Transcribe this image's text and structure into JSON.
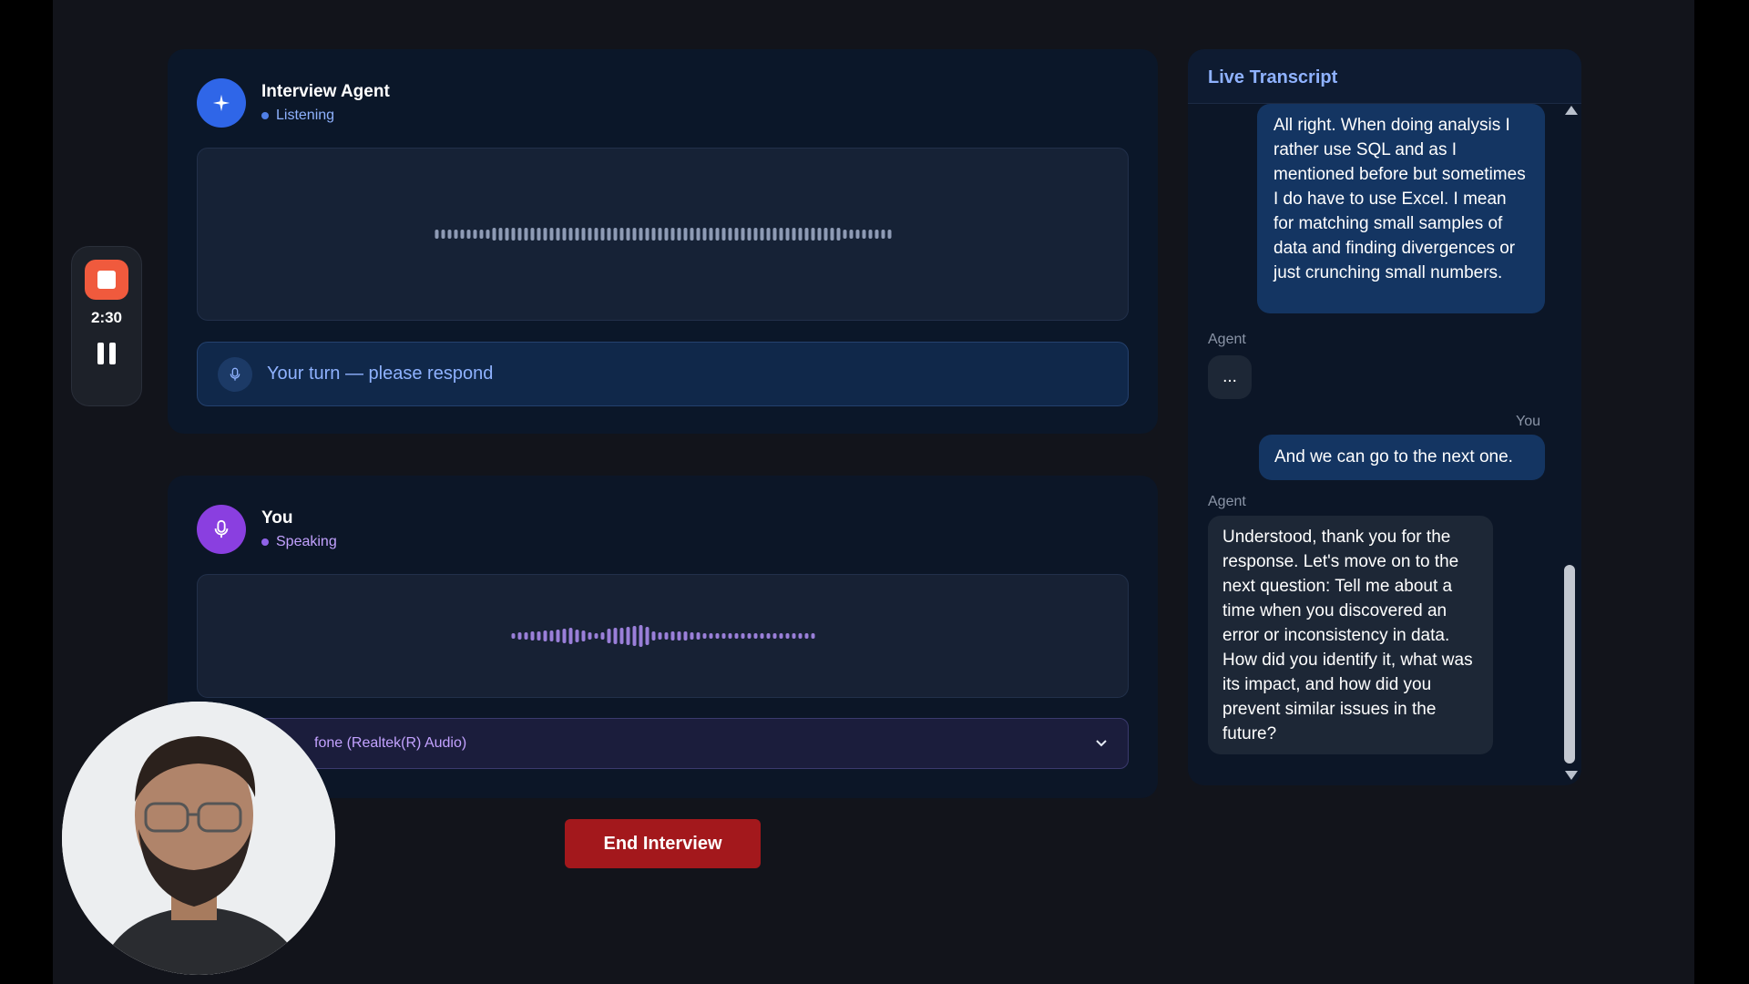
{
  "recorder": {
    "time": "2:30"
  },
  "agent_panel": {
    "title": "Interview Agent",
    "status": "Listening",
    "prompt": "Your turn — please respond"
  },
  "you_panel": {
    "title": "You",
    "status": "Speaking",
    "microphone_partial": "fone (Realtek(R) Audio)"
  },
  "end_button": "End Interview",
  "transcript": {
    "title": "Live Transcript",
    "messages": [
      {
        "speaker": "",
        "text": "All right. When doing analysis I rather use SQL and as I mentioned before but sometimes I do have to use Excel. I mean for matching small samples of data and finding divergences or just crunching small numbers."
      },
      {
        "speaker": "Agent",
        "text": "..."
      },
      {
        "speaker": "You",
        "text": "And we can go to the next one."
      },
      {
        "speaker": "Agent",
        "text": "Understood, thank you for the response. Let's move on to the next question: Tell me about a time when you discovered an error or inconsistency in data. How did you identify it, what was its impact, and how did you prevent similar issues in the future?"
      }
    ]
  },
  "colors": {
    "accent_blue": "#2f66e8",
    "accent_purple": "#8a3fe0",
    "record_red": "#f05a3d",
    "end_red": "#a3181c"
  },
  "icons": {
    "agent_avatar": "sparkle-icon",
    "you_avatar": "microphone-icon",
    "prompt": "microphone-icon",
    "select": "chevron-down-icon"
  }
}
